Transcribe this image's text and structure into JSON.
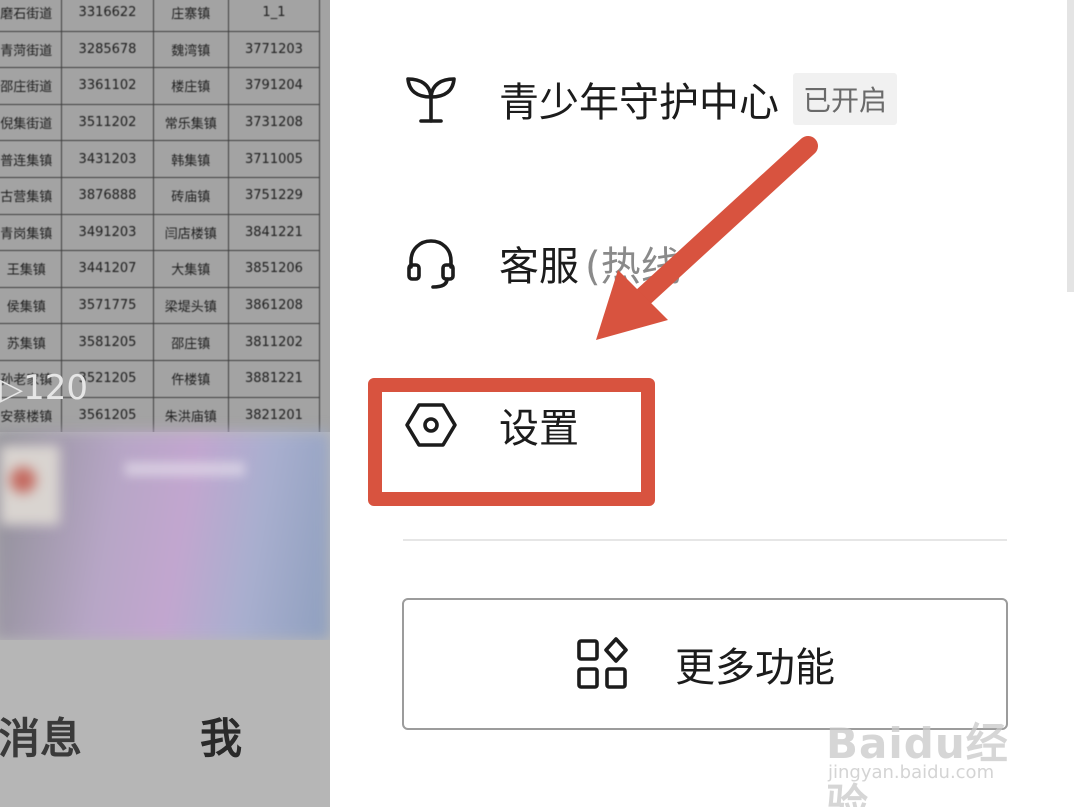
{
  "table": {
    "rows": [
      [
        "磨石街道",
        "3316622",
        "庄寨镇",
        "1_1"
      ],
      [
        "青菏街道",
        "3285678",
        "魏湾镇",
        "3771203"
      ],
      [
        "邵庄街道",
        "3361102",
        "楼庄镇",
        "3791204"
      ],
      [
        "倪集街道",
        "3511202",
        "常乐集镇",
        "3731208"
      ],
      [
        "普连集镇",
        "3431203",
        "韩集镇",
        "3711005"
      ],
      [
        "古营集镇",
        "3876888",
        "砖庙镇",
        "3751229"
      ],
      [
        "青岗集镇",
        "3491203",
        "闫店楼镇",
        "3841221"
      ],
      [
        "王集镇",
        "3441207",
        "大集镇",
        "3851206"
      ],
      [
        "侯集镇",
        "3571775",
        "梁堤头镇",
        "3861208"
      ],
      [
        "苏集镇",
        "3581205",
        "邵庄镇",
        "3811202"
      ],
      [
        "孙老家镇",
        "3521205",
        "仵楼镇",
        "3881221"
      ],
      [
        "安蔡楼镇",
        "3561205",
        "朱洪庙镇",
        "3821201"
      ]
    ]
  },
  "background": {
    "view_count": "120",
    "tabs": {
      "messages": "消息",
      "me": "我"
    }
  },
  "menu": {
    "youth": {
      "label": "青少年守护中心",
      "badge": "已开启"
    },
    "service": {
      "label": "客服",
      "sub": "(热线"
    },
    "settings": {
      "label": "设置"
    }
  },
  "more_button": {
    "label": "更多功能"
  },
  "annotation": {
    "color": "#d8533f"
  },
  "watermark": {
    "logo": "Baidu经验",
    "url": "jingyan.baidu.com"
  }
}
